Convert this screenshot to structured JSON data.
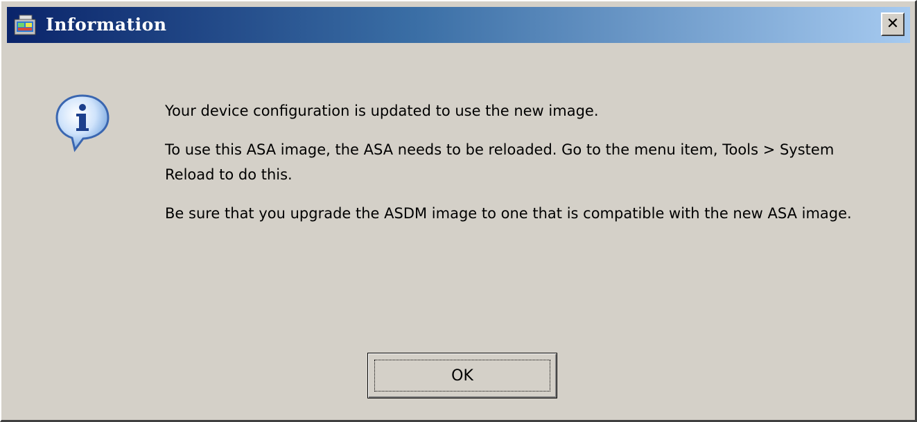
{
  "window": {
    "title": "Information",
    "close_label": "✕",
    "app_icon": "asdm-app-icon"
  },
  "dialog": {
    "icon": "info-icon",
    "messages": [
      "Your device configuration is updated to use the new image.",
      "To use this ASA image, the ASA needs to be reloaded. Go to the menu item, Tools > System Reload to do this.",
      "Be sure that you upgrade the ASDM image to one that is compatible with the new ASA image."
    ],
    "ok_label": "OK"
  }
}
